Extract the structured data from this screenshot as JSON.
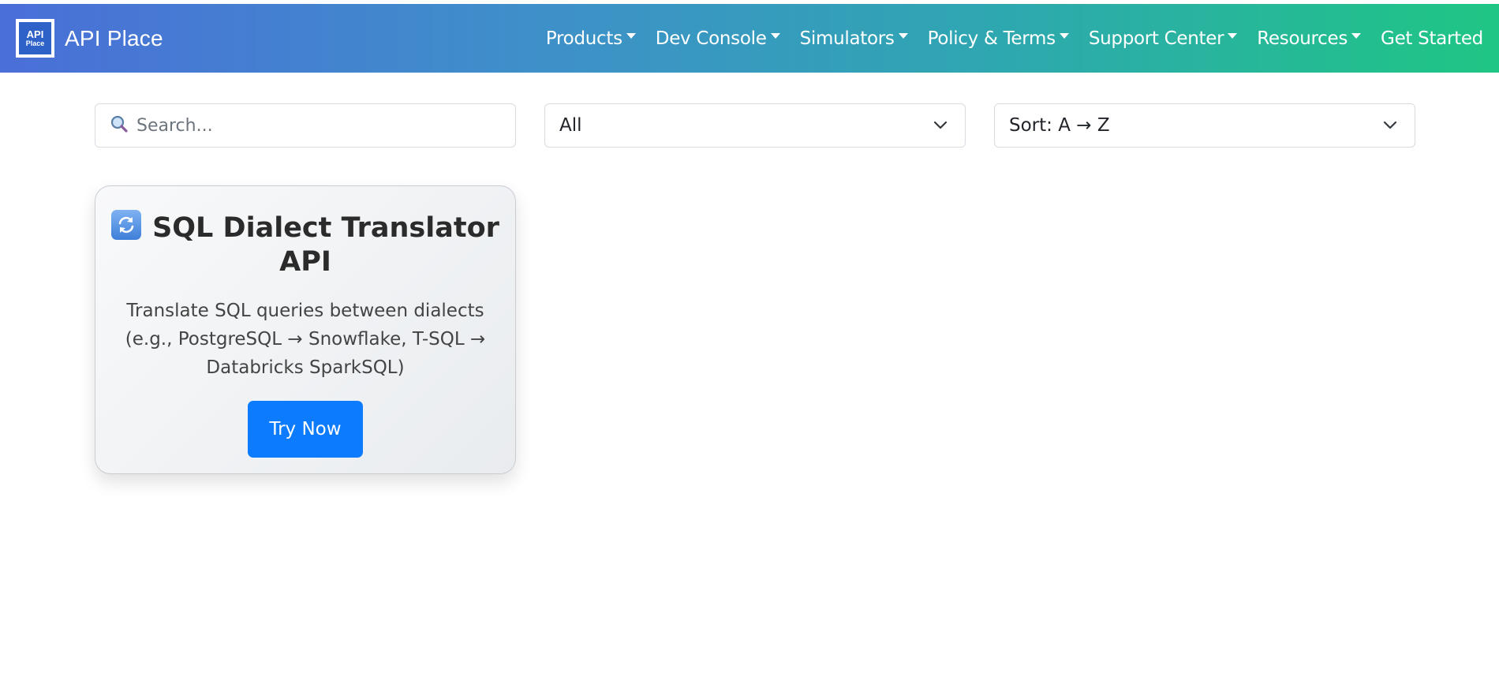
{
  "header": {
    "logo_line1": "API",
    "logo_line2": "Place",
    "brand": "API Place",
    "nav": [
      {
        "label": "Products"
      },
      {
        "label": "Dev Console"
      },
      {
        "label": "Simulators"
      },
      {
        "label": "Policy & Terms"
      },
      {
        "label": "Support Center"
      },
      {
        "label": "Resources"
      },
      {
        "label": "Get Started"
      }
    ]
  },
  "filters": {
    "search_placeholder": "Search...",
    "search_icon": "magnifier-icon",
    "category": "All",
    "sort": "Sort: A → Z"
  },
  "cards": [
    {
      "icon": "arrows-refresh-icon",
      "title": "SQL Dialect Translator API",
      "description": "Translate SQL queries between dialects (e.g., PostgreSQL → Snowflake, T-SQL → Databricks SparkSQL)",
      "button": "Try Now"
    }
  ],
  "colors": {
    "nav_gradient_start": "#4a6fd8",
    "nav_gradient_end": "#1fc684",
    "button": "#0d7bfd"
  }
}
